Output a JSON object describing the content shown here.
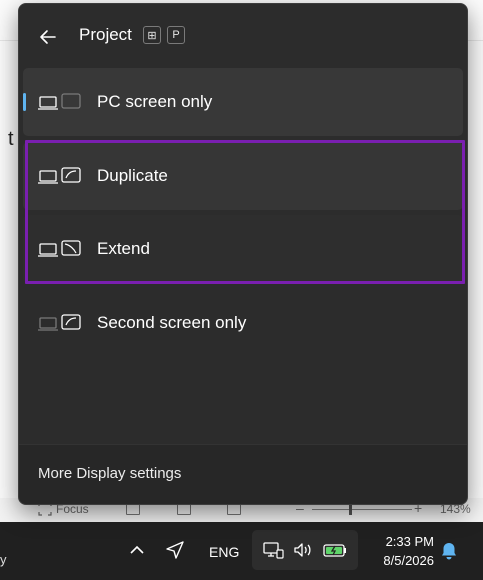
{
  "background_doc": {
    "visible_char": "t"
  },
  "statusbar": {
    "focus_label": "Focus",
    "zoom_percent": "143%",
    "zoom_minus": "–",
    "zoom_plus": "+"
  },
  "flyout": {
    "title": "Project",
    "shortcut_keys": [
      "⊞",
      "P"
    ],
    "options": [
      {
        "label": "PC screen only",
        "selected": true
      },
      {
        "label": "Duplicate",
        "selected": false
      },
      {
        "label": "Extend",
        "selected": false
      },
      {
        "label": "Second screen only",
        "selected": false
      }
    ],
    "footer_link": "More Display settings",
    "accent_color": "#5fb4f0",
    "highlight_color": "#7a1fb0"
  },
  "taskbar": {
    "edge_text": "y",
    "language": "ENG",
    "time": "2:33 PM",
    "date": "8/5/2026"
  }
}
